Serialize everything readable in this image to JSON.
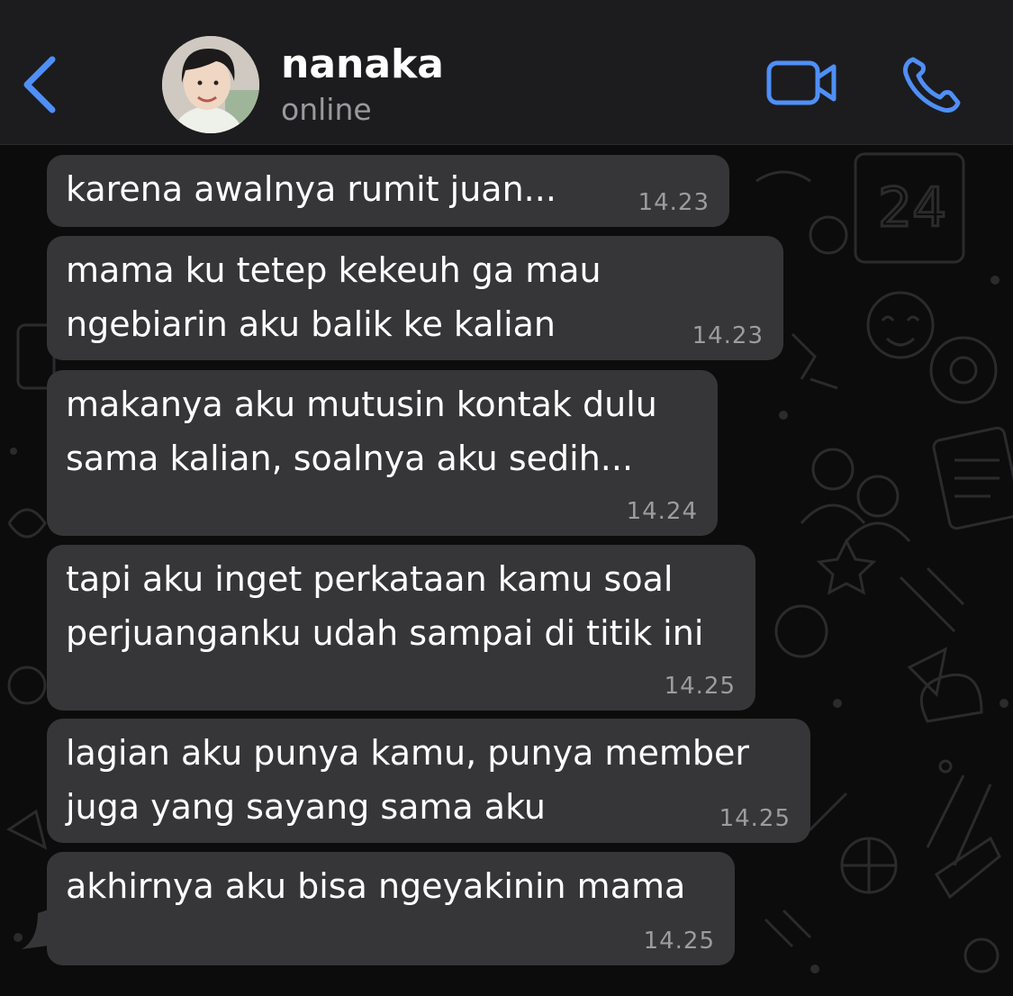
{
  "header": {
    "contact_name": "nanaka",
    "contact_status": "online",
    "accent_color": "#4f8ff7"
  },
  "icons": [
    "back-chevron-icon",
    "video-call-icon",
    "phone-call-icon"
  ],
  "messages": [
    {
      "text": "karena awalnya rumit juan...",
      "time": "14.23"
    },
    {
      "text": "mama ku tetep kekeuh ga mau\nngebiarin aku balik ke kalian",
      "time": "14.23"
    },
    {
      "text": "makanya aku mutusin kontak dulu\nsama kalian, soalnya aku sedih...",
      "time": "14.24"
    },
    {
      "text": "tapi aku inget perkataan kamu soal\nperjuanganku udah sampai di titik ini",
      "time": "14.25"
    },
    {
      "text": "lagian aku punya kamu, punya member\njuga yang sayang sama aku",
      "time": "14.25"
    },
    {
      "text": "akhirnya aku bisa ngeyakinin mama",
      "time": "14.25"
    }
  ]
}
